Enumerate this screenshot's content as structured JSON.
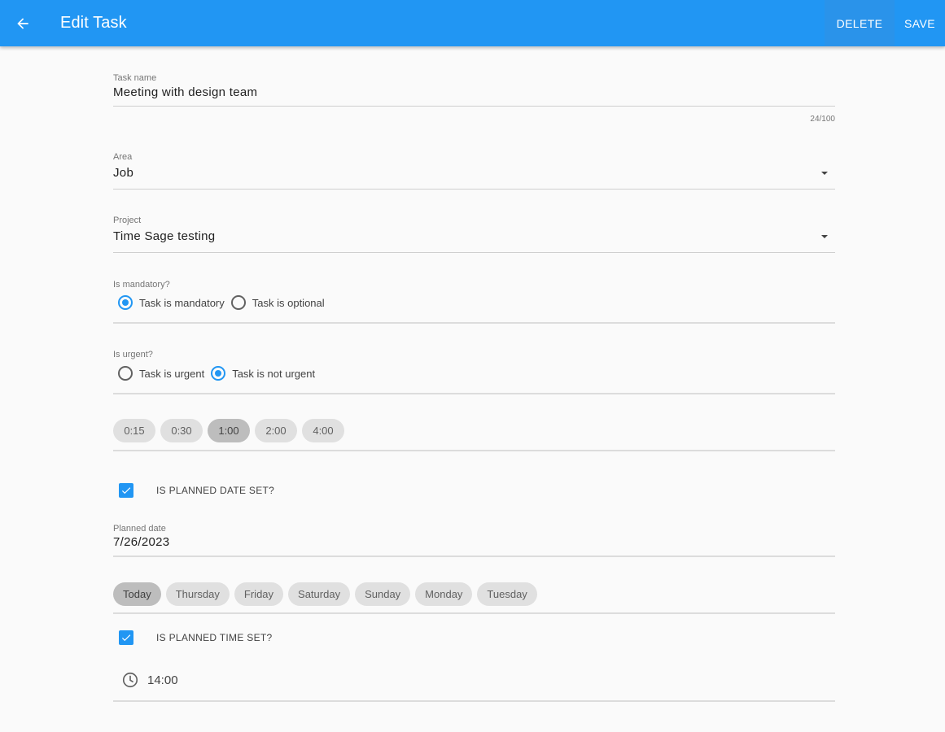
{
  "appbar": {
    "title": "Edit Task",
    "back_icon": "arrow-left-icon",
    "actions": {
      "delete": "DELETE",
      "save": "SAVE"
    },
    "color": "#2196f3"
  },
  "task_name": {
    "label": "Task name",
    "value": "Meeting with design team",
    "counter": "24/100"
  },
  "area": {
    "label": "Area",
    "value": "Job"
  },
  "project": {
    "label": "Project",
    "value": "Time Sage testing"
  },
  "mandatory": {
    "label": "Is mandatory?",
    "options": [
      {
        "label": "Task is mandatory",
        "checked": true
      },
      {
        "label": "Task is optional",
        "checked": false
      }
    ]
  },
  "urgent": {
    "label": "Is urgent?",
    "options": [
      {
        "label": "Task is urgent",
        "checked": false
      },
      {
        "label": "Task is not urgent",
        "checked": true
      }
    ]
  },
  "duration_chips": [
    {
      "label": "0:15",
      "selected": false
    },
    {
      "label": "0:30",
      "selected": false
    },
    {
      "label": "1:00",
      "selected": true
    },
    {
      "label": "2:00",
      "selected": false
    },
    {
      "label": "4:00",
      "selected": false
    }
  ],
  "planned_date_checkbox": {
    "label": "IS PLANNED DATE SET?",
    "checked": true
  },
  "planned_date": {
    "label": "Planned date",
    "value": "7/26/2023"
  },
  "day_chips": [
    {
      "label": "Today",
      "selected": true
    },
    {
      "label": "Thursday",
      "selected": false
    },
    {
      "label": "Friday",
      "selected": false
    },
    {
      "label": "Saturday",
      "selected": false
    },
    {
      "label": "Sunday",
      "selected": false
    },
    {
      "label": "Monday",
      "selected": false
    },
    {
      "label": "Tuesday",
      "selected": false
    }
  ],
  "planned_time_checkbox": {
    "label": "IS PLANNED TIME SET?",
    "checked": true
  },
  "planned_time": {
    "icon": "clock-icon",
    "value": "14:00"
  }
}
